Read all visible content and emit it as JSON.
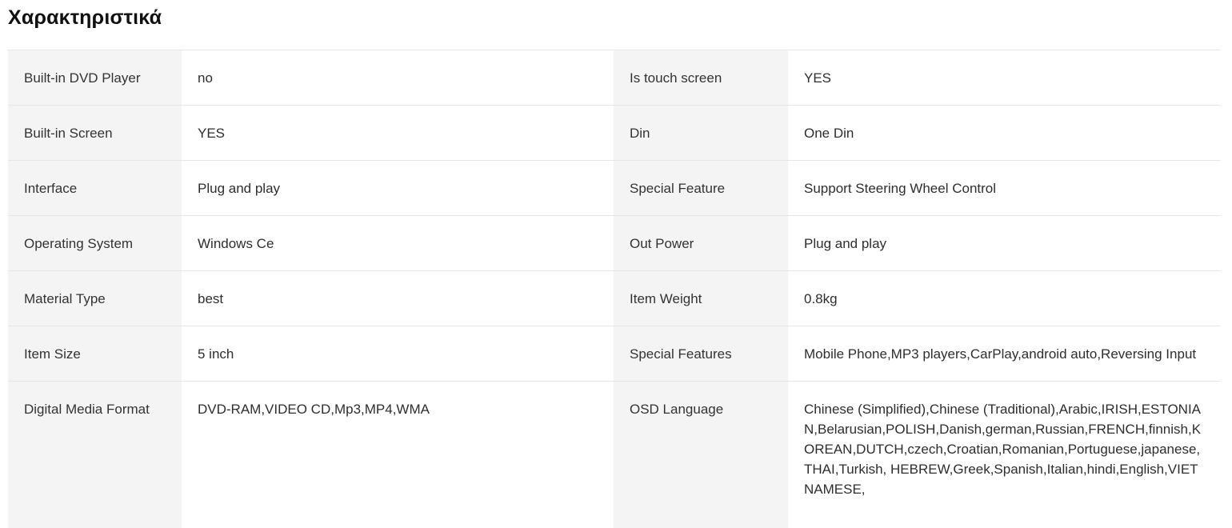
{
  "title": "Χαρακτηριστικά",
  "rows": [
    {
      "left": {
        "key": "Built-in DVD Player",
        "value": "no"
      },
      "right": {
        "key": "Is touch screen",
        "value": "YES"
      }
    },
    {
      "left": {
        "key": "Built-in Screen",
        "value": "YES"
      },
      "right": {
        "key": "Din",
        "value": "One Din"
      }
    },
    {
      "left": {
        "key": "Interface",
        "value": "Plug and play"
      },
      "right": {
        "key": "Special Feature",
        "value": "Support Steering Wheel Control"
      }
    },
    {
      "left": {
        "key": "Operating System",
        "value": "Windows Ce"
      },
      "right": {
        "key": "Out Power",
        "value": "Plug and play"
      }
    },
    {
      "left": {
        "key": "Material Type",
        "value": "best"
      },
      "right": {
        "key": "Item Weight",
        "value": "0.8kg"
      }
    },
    {
      "left": {
        "key": "Item Size",
        "value": "5 inch"
      },
      "right": {
        "key": "Special Features",
        "value": "Mobile Phone,MP3 players,CarPlay,android auto,Reversing Input"
      }
    },
    {
      "left": {
        "key": "Digital Media Format",
        "value": "DVD-RAM,VIDEO CD,Mp3,MP4,WMA"
      },
      "right": {
        "key": "OSD Language",
        "value": "Chinese (Simplified),Chinese (Traditional),Arabic,IRISH,ESTONIAN,Belarusian,POLISH,Danish,german,Russian,FRENCH,finnish,KOREAN,DUTCH,czech,Croatian,Romanian,Portuguese,japanese,THAI,Turkish, HEBREW,Greek,Spanish,Italian,hindi,English,VIETNAMESE,"
      }
    }
  ]
}
